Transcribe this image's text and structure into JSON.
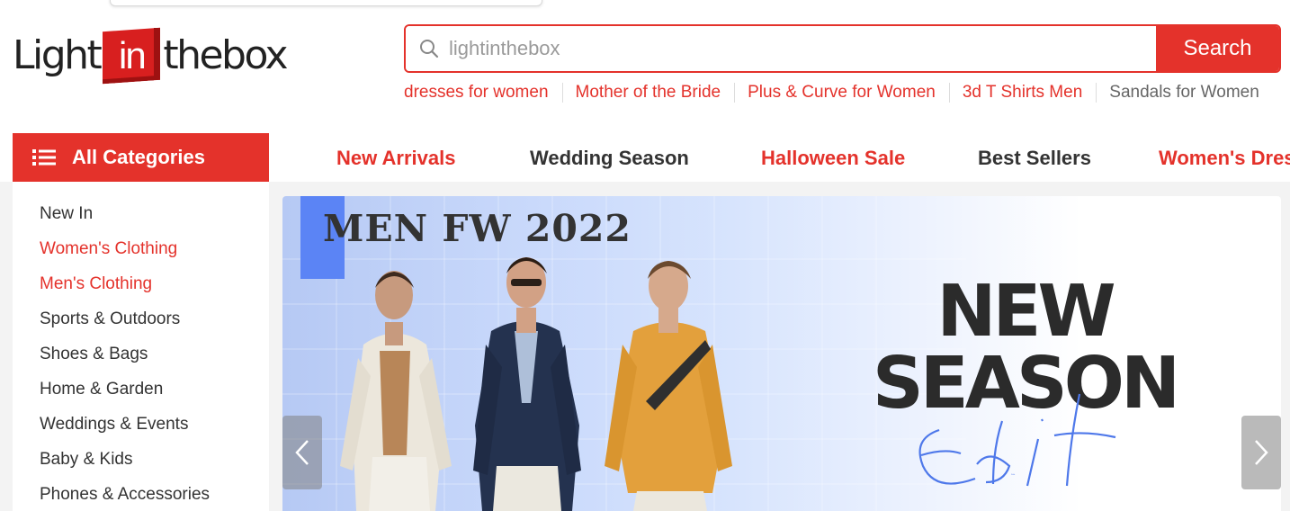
{
  "logo": {
    "left_text": "Light",
    "box_text": "in",
    "right_text": "thebox"
  },
  "search": {
    "placeholder": "lightinthebox",
    "button_label": "Search"
  },
  "hot_words": [
    "dresses for women",
    "Mother of the Bride",
    "Plus & Curve for Women",
    "3d T Shirts Men",
    "Sandals for Women"
  ],
  "category_button": {
    "label": "All Categories"
  },
  "top_nav": [
    {
      "label": "New Arrivals",
      "color": "#e4322b"
    },
    {
      "label": "Wedding Season",
      "color": "#333333"
    },
    {
      "label": "Halloween Sale",
      "color": "#e4322b"
    },
    {
      "label": "Best Sellers",
      "color": "#333333"
    },
    {
      "label": "Women's Dresses",
      "color": "#e4322b"
    }
  ],
  "sidebar": {
    "items": [
      {
        "label": "New In",
        "highlight": false
      },
      {
        "label": "Women's Clothing",
        "highlight": true
      },
      {
        "label": "Men's Clothing",
        "highlight": true
      },
      {
        "label": "Sports & Outdoors",
        "highlight": false
      },
      {
        "label": "Shoes & Bags",
        "highlight": false
      },
      {
        "label": "Home & Garden",
        "highlight": false
      },
      {
        "label": "Weddings & Events",
        "highlight": false
      },
      {
        "label": "Baby & Kids",
        "highlight": false
      },
      {
        "label": "Phones & Accessories",
        "highlight": false
      }
    ]
  },
  "banner": {
    "headline": "MEN FW 2022",
    "title_line1": "NEW",
    "title_line2": "SEASON",
    "script_word": "Edit"
  },
  "colors": {
    "brand_red": "#e4322b",
    "accent_blue": "#5b84f5"
  }
}
